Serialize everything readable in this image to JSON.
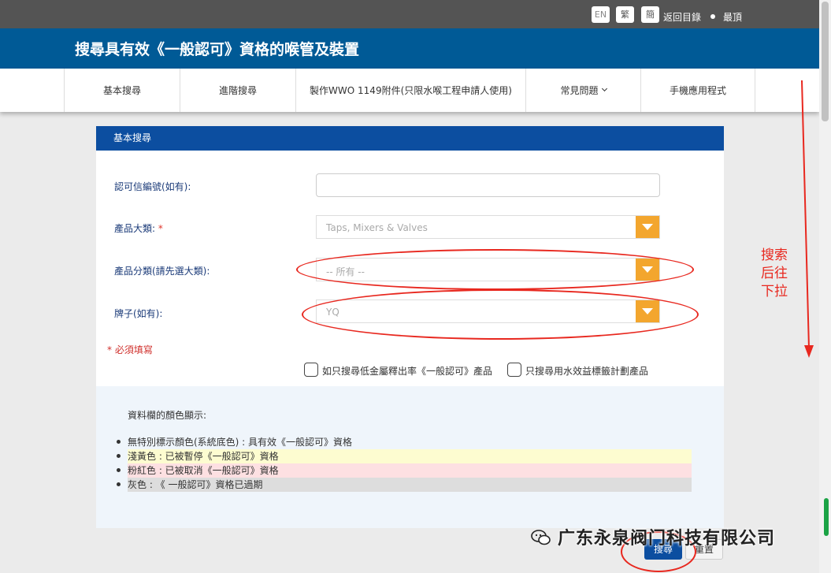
{
  "topbar": {
    "lang_en": "EN",
    "lang_tc": "繁",
    "lang_sc": "簡",
    "back_link": "返回目錄",
    "top_link": "最頂"
  },
  "title": "搜尋具有效《一般認可》資格的喉管及裝置",
  "nav": [
    {
      "label": "基本搜尋"
    },
    {
      "label": "進階搜尋"
    },
    {
      "label": "製作WWO 1149附件(只限水喉工程申請人使用)"
    },
    {
      "label": "常見問題"
    },
    {
      "label": "手機應用程式"
    }
  ],
  "panel": {
    "heading": "基本搜尋",
    "fields": {
      "license_label": "認可信編號(如有):",
      "license_value": "",
      "category_label": "產品大類:",
      "category_star": "*",
      "category_value": "Taps, Mixers & Valves",
      "subcategory_label": "產品分類(請先選大類):",
      "subcategory_value": "-- 所有 --",
      "brand_label": "牌子(如有):",
      "brand_value": "YQ"
    },
    "required_note": "* 必須填寫",
    "checkbox_lead": "如只搜尋低金屬釋出率《一般認可》產品",
    "checkbox_water": "只搜尋用水效益標籤計劃產品"
  },
  "legend": {
    "title": "資料欄的顏色顯示:",
    "rows": [
      {
        "text": "無特別標示顏色(系統底色) : 具有效《一般認可》資格",
        "color": "#eff5fb"
      },
      {
        "text": "淺黃色 : 已被暫停《一般認可》資格",
        "color": "#fdfcd0"
      },
      {
        "text": "粉紅色 : 已被取消《一般認可》資格",
        "color": "#fde0e2"
      },
      {
        "text": "灰色 : 《 一般認可》資格已過期",
        "color": "#dddddd"
      }
    ]
  },
  "buttons": {
    "search": "搜尋",
    "reset": "重置"
  },
  "annotation": {
    "note": "搜索后往下拉",
    "color": "#e8281f"
  },
  "watermark": "广东永泉阀门科技有限公司",
  "colors": {
    "header_blue": "#005a96",
    "panel_blue": "#0c4ea0",
    "dropdown_orange": "#f3a62e"
  }
}
